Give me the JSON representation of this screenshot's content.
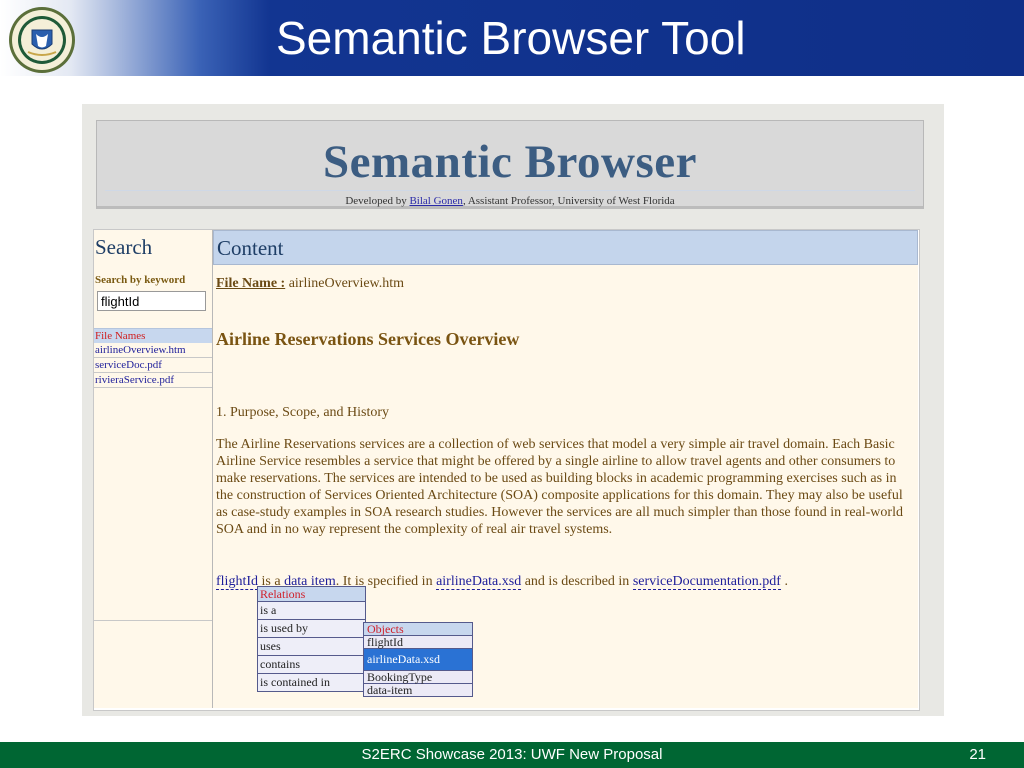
{
  "slide": {
    "title": "Semantic Browser Tool",
    "footer": "S2ERC Showcase 2013: UWF New Proposal",
    "page_number": "21",
    "colors": {
      "header_blue": "#0f2f88",
      "footer_green": "#006633"
    }
  },
  "app": {
    "banner": {
      "title": "Semantic Browser",
      "developed_by_prefix": "Developed by ",
      "author": "Bilal Gonen",
      "developed_by_suffix": ", Assistant Professor, University of West Florida"
    },
    "search": {
      "heading": "Search",
      "keyword_label": "Search by keyword",
      "keyword_value": "flightId",
      "file_names_header": "File Names",
      "files": [
        "airlineOverview.htm",
        "serviceDoc.pdf",
        "rivieraService.pdf"
      ]
    },
    "content": {
      "heading": "Content",
      "file_name_label": "File Name :",
      "file_name_value": " airlineOverview.htm",
      "doc_title": "Airline Reservations Services Overview",
      "section_heading": "1. Purpose, Scope, and History",
      "paragraph": "The Airline Reservations services are a collection of web services that model a very simple air travel domain. Each Basic Airline Service resembles a service that might be offered by a single airline to allow travel agents and other consumers to make reservations. The services are intended to be used as building blocks in academic programming exercises such as in the construction of Services Oriented Architecture (SOA) composite applications for this domain. They may also be useful as case-study examples in SOA research studies. However the services are all much simpler than those found in real-world SOA and in no way represent the complexity of real air travel systems.",
      "link_line": {
        "link1": "flightId",
        "text1": " is a ",
        "link2": "data item",
        "text2": ". It is specified in ",
        "link3": "airlineData.xsd",
        "text3": " and is described in ",
        "link4": "serviceDocumentation.pdf",
        "text4": " ."
      }
    },
    "relations_popup": {
      "header": "Relations",
      "items": [
        "is a",
        "is used by",
        "uses",
        "contains",
        "is contained in"
      ]
    },
    "objects_popup": {
      "header": "Objects",
      "items": [
        "flightId",
        "airlineData.xsd",
        "BookingType",
        "data-item"
      ],
      "selected": "airlineData.xsd"
    }
  }
}
